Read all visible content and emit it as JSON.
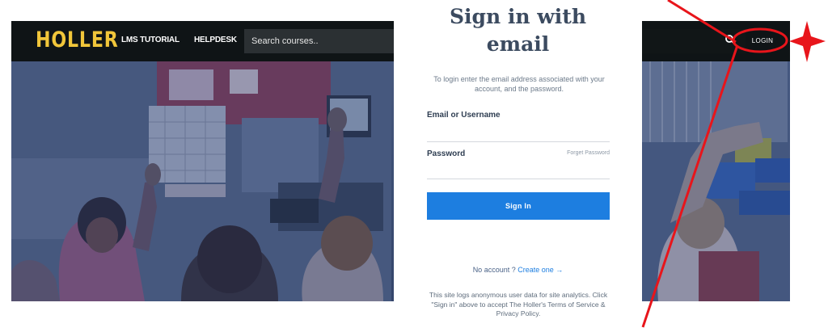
{
  "site": {
    "logo": "HOLLER",
    "nav": [
      {
        "label": "LMS TUTORIAL"
      },
      {
        "label": "HELPDESK"
      }
    ],
    "search_placeholder": "Search courses..",
    "login_label": "LOGIN"
  },
  "modal": {
    "title_line1": "Sign in with",
    "title_line2": "email",
    "description": "To login enter the email address associated with your account, and the password.",
    "email_label": "Email or Username",
    "password_label": "Password",
    "forgot_label": "Forget Password",
    "signin_label": "Sign In",
    "no_account": "No account ?",
    "create_label": "Create one",
    "create_arrow": "→",
    "notice": "This site logs anonymous user data for site analytics. Click \"Sign in\" above to accept The Holler's Terms of Service & Privacy Policy."
  },
  "colors": {
    "header_bg": "#0f1416",
    "logo": "#f1c63a",
    "button_primary": "#1d7ee0",
    "title_text": "#3c4b60",
    "annotation": "#e8151b"
  },
  "icons": {
    "search": "search-icon",
    "star": "four-point-star-icon",
    "arrow": "arrow-right-icon"
  }
}
